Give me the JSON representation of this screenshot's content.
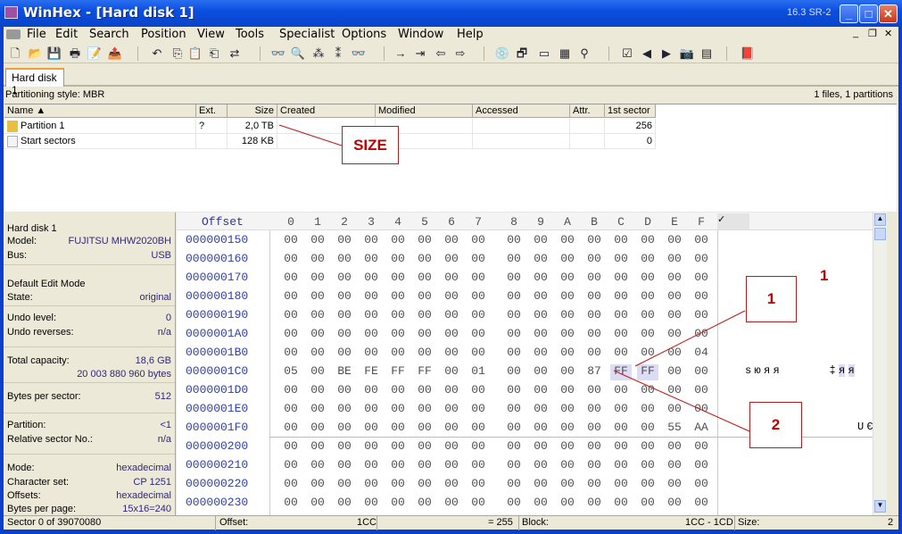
{
  "window": {
    "title": "WinHex - [Hard disk 1]",
    "version": "16.3 SR-2",
    "min": "_",
    "max": "□",
    "close": "✕"
  },
  "menu": [
    "File",
    "Edit",
    "Search",
    "Position",
    "View",
    "Tools",
    "Specialist",
    "Options",
    "Window",
    "Help"
  ],
  "mdi": {
    "min": "_",
    "restore": "❐",
    "close": "✕"
  },
  "toolbar": [
    {
      "icon": "new-file-icon",
      "g": "🗋"
    },
    {
      "icon": "open-icon",
      "g": "📂"
    },
    {
      "icon": "save-icon",
      "g": "💾"
    },
    {
      "icon": "print-icon",
      "g": "🖶"
    },
    {
      "icon": "properties-icon",
      "g": "📝"
    },
    {
      "icon": "open-folder-icon",
      "g": "📤"
    },
    {
      "icon": "undo-icon",
      "g": "↶"
    },
    {
      "icon": "copy-icon",
      "g": "⎘"
    },
    {
      "icon": "paste-icon",
      "g": "📋"
    },
    {
      "icon": "paste-disabled-icon",
      "g": "⎗"
    },
    {
      "icon": "binary-convert-icon",
      "g": "⇄"
    },
    {
      "icon": "find-text-icon",
      "g": "👓"
    },
    {
      "icon": "find-hex-icon",
      "g": "🔍"
    },
    {
      "icon": "replace-text-icon",
      "g": "⁂"
    },
    {
      "icon": "replace-hex-icon",
      "g": "⁑"
    },
    {
      "icon": "find-again-icon",
      "g": "👓"
    },
    {
      "icon": "goto-offset-icon",
      "g": "→"
    },
    {
      "icon": "goto-sector-icon",
      "g": "⇥"
    },
    {
      "icon": "back-icon",
      "g": "⇦"
    },
    {
      "icon": "forward-icon",
      "g": "⇨"
    },
    {
      "icon": "open-disk-icon",
      "g": "💿"
    },
    {
      "icon": "clone-disk-icon",
      "g": "🗗"
    },
    {
      "icon": "ram-icon",
      "g": "▭"
    },
    {
      "icon": "calculator-icon",
      "g": "▦"
    },
    {
      "icon": "magnifier-icon",
      "g": "⚲"
    },
    {
      "icon": "checksum-icon",
      "g": "☑"
    },
    {
      "icon": "previous-sector-icon",
      "g": "◀"
    },
    {
      "icon": "next-sector-icon",
      "g": "▶"
    },
    {
      "icon": "snapshot-icon",
      "g": "📷"
    },
    {
      "icon": "table-icon",
      "g": "▤"
    },
    {
      "icon": "help-book-icon",
      "g": "📕"
    }
  ],
  "tab": "Hard disk 1",
  "partitioning": "Partitioning style: MBR",
  "partition_count": "1 files, 1 partitions",
  "table": {
    "headers": [
      "Name ▲",
      "Ext.",
      "Size",
      "Created",
      "Modified",
      "Accessed",
      "Attr.",
      "1st sector"
    ],
    "rows": [
      [
        "Partition 1",
        "?",
        "2,0 TB",
        "",
        "",
        "",
        "",
        "256"
      ],
      [
        "Start sectors",
        "",
        "128 KB",
        "",
        "",
        "",
        "",
        "0"
      ]
    ]
  },
  "info": [
    {
      "l": "Hard disk 1",
      "v": ""
    },
    {
      "l": "Model:",
      "v": "FUJITSU MHW2020BH"
    },
    {
      "l": "Bus:",
      "v": "USB"
    },
    {
      "l": "Default Edit Mode",
      "v": ""
    },
    {
      "l": "State:",
      "v": "original"
    },
    {
      "l": "Undo level:",
      "v": "0"
    },
    {
      "l": "Undo reverses:",
      "v": "n/a"
    },
    {
      "l": "Total capacity:",
      "v": "18,6 GB"
    },
    {
      "l": "",
      "v": "20 003 880 960 bytes"
    },
    {
      "l": "Bytes per sector:",
      "v": "512"
    },
    {
      "l": "Partition:",
      "v": "<1"
    },
    {
      "l": "Relative sector No.:",
      "v": "n/a"
    },
    {
      "l": "Mode:",
      "v": "hexadecimal"
    },
    {
      "l": "Character set:",
      "v": "CP 1251"
    },
    {
      "l": "Offsets:",
      "v": "hexadecimal"
    },
    {
      "l": "Bytes per page:",
      "v": "15x16=240"
    }
  ],
  "hex": {
    "offset_label": "Offset",
    "columns": [
      "0",
      "1",
      "2",
      "3",
      "4",
      "5",
      "6",
      "7",
      "8",
      "9",
      "A",
      "B",
      "C",
      "D",
      "E",
      "F"
    ],
    "rows": [
      {
        "o": "000000150",
        "b": "00 00 00 00 00 00 00 00 00 00 00 00 00 00 00 00",
        "t": ""
      },
      {
        "o": "000000160",
        "b": "00 00 00 00 00 00 00 00 00 00 00 00 00 00 00 00",
        "t": ""
      },
      {
        "o": "000000170",
        "b": "00 00 00 00 00 00 00 00 00 00 00 00 00 00 00 00",
        "t": ""
      },
      {
        "o": "000000180",
        "b": "00 00 00 00 00 00 00 00 00 00 00 00 00 00 00 00",
        "t": ""
      },
      {
        "o": "000000190",
        "b": "00 00 00 00 00 00 00 00 00 00 00 00 00 00 00 00",
        "t": ""
      },
      {
        "o": "0000001A0",
        "b": "00 00 00 00 00 00 00 00 00 00 00 00 00 00 00 00",
        "t": ""
      },
      {
        "o": "0000001B0",
        "b": "00 00 00 00 00 00 00 00 00 00 00 00 00 00 00 04",
        "t": ""
      },
      {
        "o": "0000001C0",
        "b": "05 00 BE FE FF FF 00 01 00 00 00 87 FF FF 00 00",
        "t": "  ѕюяя     ‡яя  "
      },
      {
        "o": "0000001D0",
        "b": "00 00 00 00 00 00 00 00 00 00 00 00 00 00 00 00",
        "t": ""
      },
      {
        "o": "0000001E0",
        "b": "00 00 00 00 00 00 00 00 00 00 00 00 00 00 00 00",
        "t": ""
      },
      {
        "o": "0000001F0",
        "b": "00 00 00 00 00 00 00 00 00 00 00 00 00 00 55 AA",
        "t": "              UЄ"
      },
      {
        "o": "000000200",
        "b": "00 00 00 00 00 00 00 00 00 00 00 00 00 00 00 00",
        "t": ""
      },
      {
        "o": "000000210",
        "b": "00 00 00 00 00 00 00 00 00 00 00 00 00 00 00 00",
        "t": ""
      },
      {
        "o": "000000220",
        "b": "00 00 00 00 00 00 00 00 00 00 00 00 00 00 00 00",
        "t": ""
      },
      {
        "o": "000000230",
        "b": "00 00 00 00 00 00 00 00 00 00 00 00 00 00 00 00",
        "t": ""
      }
    ],
    "selected": [
      "0000001C0",
      12,
      13
    ],
    "selection_color": "#dcdcf4"
  },
  "annotations": {
    "size": "SIZE",
    "one": "1",
    "two": "2",
    "one_red": "1"
  },
  "status": {
    "sector": "Sector 0 of 39070080",
    "offset_label": "Offset:",
    "offset": "1CC",
    "value": "= 255",
    "block_label": "Block:",
    "block": "1CC - 1CD",
    "size_label": "Size:",
    "size": "2"
  }
}
